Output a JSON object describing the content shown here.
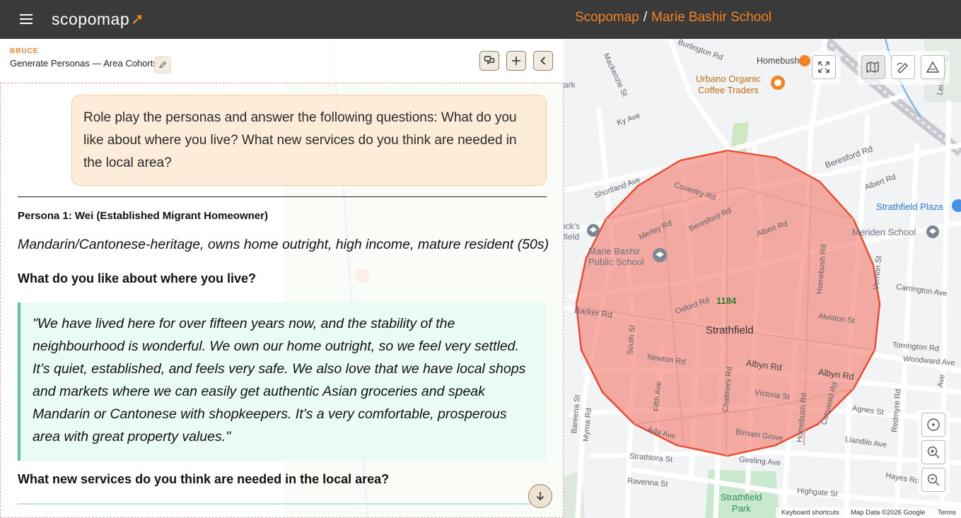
{
  "topbar": {
    "logo_text": "scopomap",
    "crumb_root": "Scopomap",
    "crumb_sep": "/",
    "crumb_page": "Marie Bashir School"
  },
  "panel": {
    "user": "BRUCE",
    "session_title": "Generate Personas — Area Cohorts"
  },
  "chat": {
    "prompt": "Role play the personas and answer the following questions: What do you like about where you live? What new services do you think are needed in the local area?",
    "persona_title": "Persona 1: Wei (Established Migrant Homeowner)",
    "persona_desc": "Mandarin/Cantonese-heritage, owns home outright, high income, mature resident (50s)",
    "q1": "What do you like about where you live?",
    "a1": "\"We have lived here for over fifteen years now, and the stability of the neighbourhood is wonderful. We own our home outright, so we feel very settled. It’s quiet, established, and feels very safe. We also love that we have local shops and markets where we can easily get authentic Asian groceries and speak Mandarin or Cantonese with shopkeepers. It’s a very comfortable, prosperous area with great property values.\"",
    "q2": "What new services do you think are needed in the local area?"
  },
  "map": {
    "polygon_count": "1184",
    "labels": {
      "suburb": "Strathfield",
      "school": "Marie Bashir\nPublic School",
      "homebush": "Homebush",
      "urbano": "Urbano Organic\nCoffee Traders",
      "plaza": "Strathfield Plaza",
      "meriden": "Meriden School",
      "park": "Strathfield\nPark",
      "field_left": "ick's\nfield",
      "park_left": "ark",
      "burlington": "Burlington Rd",
      "mackenzie": "Mackenzie St",
      "leicester": "Leicester St",
      "beresford_e": "Beresford Rd",
      "beresford_w": "Beresford Rd",
      "coventry": "Coventry Rd",
      "shortland": "Shortland Ave",
      "merley": "Merley Rd",
      "albert_w": "Albert Rd",
      "albert_e": "Albert Rd",
      "homebush_rd_n": "Homebush Rd",
      "homebush_rd_s": "Homebush Rd",
      "vernon": "Vernon St",
      "carrington": "Carrington Ave",
      "barker": "Barker Rd",
      "oxford": "Oxford Rd",
      "alviston": "Alviston St",
      "south_st": "South St",
      "newton": "Newton Rd",
      "albyn_1": "Albyn Rd",
      "albyn_2": "Albyn Rd",
      "torrington": "Torrington Rd",
      "woodward": "Woodward Ave",
      "fifth": "Fifth Ave",
      "chalmers": "Chalmers Rd",
      "victoria": "Victoria St",
      "agnes": "Agnes St",
      "bareena": "Bareena St",
      "myrna": "Myrna Rd",
      "ada": "Ada Ave",
      "birnam": "Birnam Grove",
      "cotswold": "Cotswold Rd",
      "landilo": "Llandilo Ave",
      "redmyre": "Redmyre Rd",
      "strathlora": "Strathlora St",
      "geling": "Geeling Ave",
      "ravenna": "Ravenna St",
      "highgate": "Highgate St",
      "hayes": "Hayes Rd",
      "ky_ave": "Ky Ave",
      "ave_e": "Ave"
    },
    "attribution": {
      "shortcuts": "Keyboard shortcuts",
      "data": "Map Data ©2026 Google",
      "terms": "Terms"
    }
  },
  "icons": {
    "menu": "hamburger-menu-icon",
    "edit": "pencil-icon",
    "personas": "chat-bubbles-icon",
    "add": "plus-icon",
    "collapse": "chevron-left-icon",
    "scroll": "arrow-down-icon",
    "fullscreen": "fullscreen-icon",
    "map_style": "map-icon",
    "draw": "draw-icon",
    "terrain": "triangle-icon",
    "locate": "locate-icon",
    "zoom_in": "zoom-in-icon",
    "zoom_out": "zoom-out-icon"
  },
  "colors": {
    "accent": "#f58220",
    "topbar": "#3a3a3a",
    "polygon_fill": "#f26b5b",
    "polygon_stroke": "#e8492f",
    "quote_border": "#5cc7a6",
    "count_label": "#2e7d2e"
  }
}
